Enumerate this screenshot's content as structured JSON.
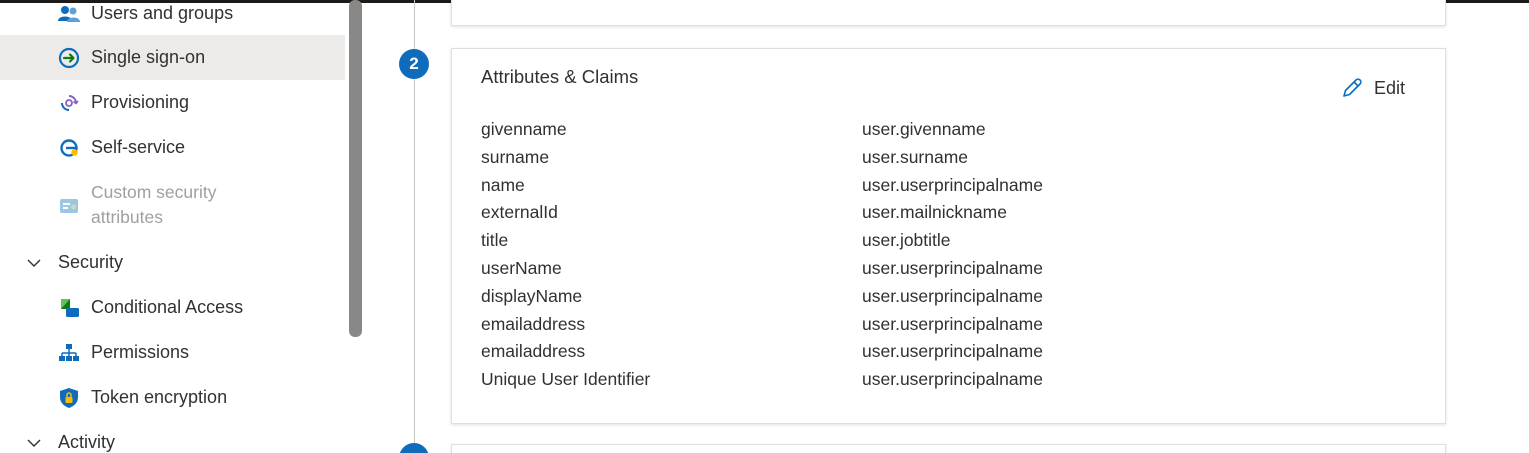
{
  "sidebar": {
    "items": [
      {
        "label": "Users and groups",
        "icon": "users-groups-icon"
      },
      {
        "label": "Single sign-on",
        "icon": "single-sign-on-icon"
      },
      {
        "label": "Provisioning",
        "icon": "provisioning-icon"
      },
      {
        "label": "Self-service",
        "icon": "self-service-icon"
      },
      {
        "label_line1": "Custom security",
        "label_line2": "attributes",
        "icon": "custom-security-attributes-icon"
      }
    ],
    "security": {
      "label": "Security",
      "items": [
        {
          "label": "Conditional Access",
          "icon": "conditional-access-icon"
        },
        {
          "label": "Permissions",
          "icon": "permissions-icon"
        },
        {
          "label": "Token encryption",
          "icon": "token-encryption-icon"
        }
      ]
    },
    "activity": {
      "label": "Activity"
    }
  },
  "steps": {
    "current_number": "2"
  },
  "attributes_claims": {
    "title": "Attributes & Claims",
    "edit_label": "Edit",
    "rows": [
      {
        "name": "givenname",
        "value": "user.givenname"
      },
      {
        "name": "surname",
        "value": "user.surname"
      },
      {
        "name": "name",
        "value": "user.userprincipalname"
      },
      {
        "name": "externalId",
        "value": "user.mailnickname"
      },
      {
        "name": "title",
        "value": "user.jobtitle"
      },
      {
        "name": "userName",
        "value": "user.userprincipalname"
      },
      {
        "name": "displayName",
        "value": "user.userprincipalname"
      },
      {
        "name": "emailaddress",
        "value": "user.userprincipalname"
      },
      {
        "name": "emailaddress",
        "value": "user.userprincipalname"
      },
      {
        "name": "Unique User Identifier",
        "value": "user.userprincipalname"
      }
    ]
  },
  "colors": {
    "accent": "#0f6cbd",
    "active_nav_bg": "#edebe9",
    "disabled_text": "#a19f9d"
  }
}
